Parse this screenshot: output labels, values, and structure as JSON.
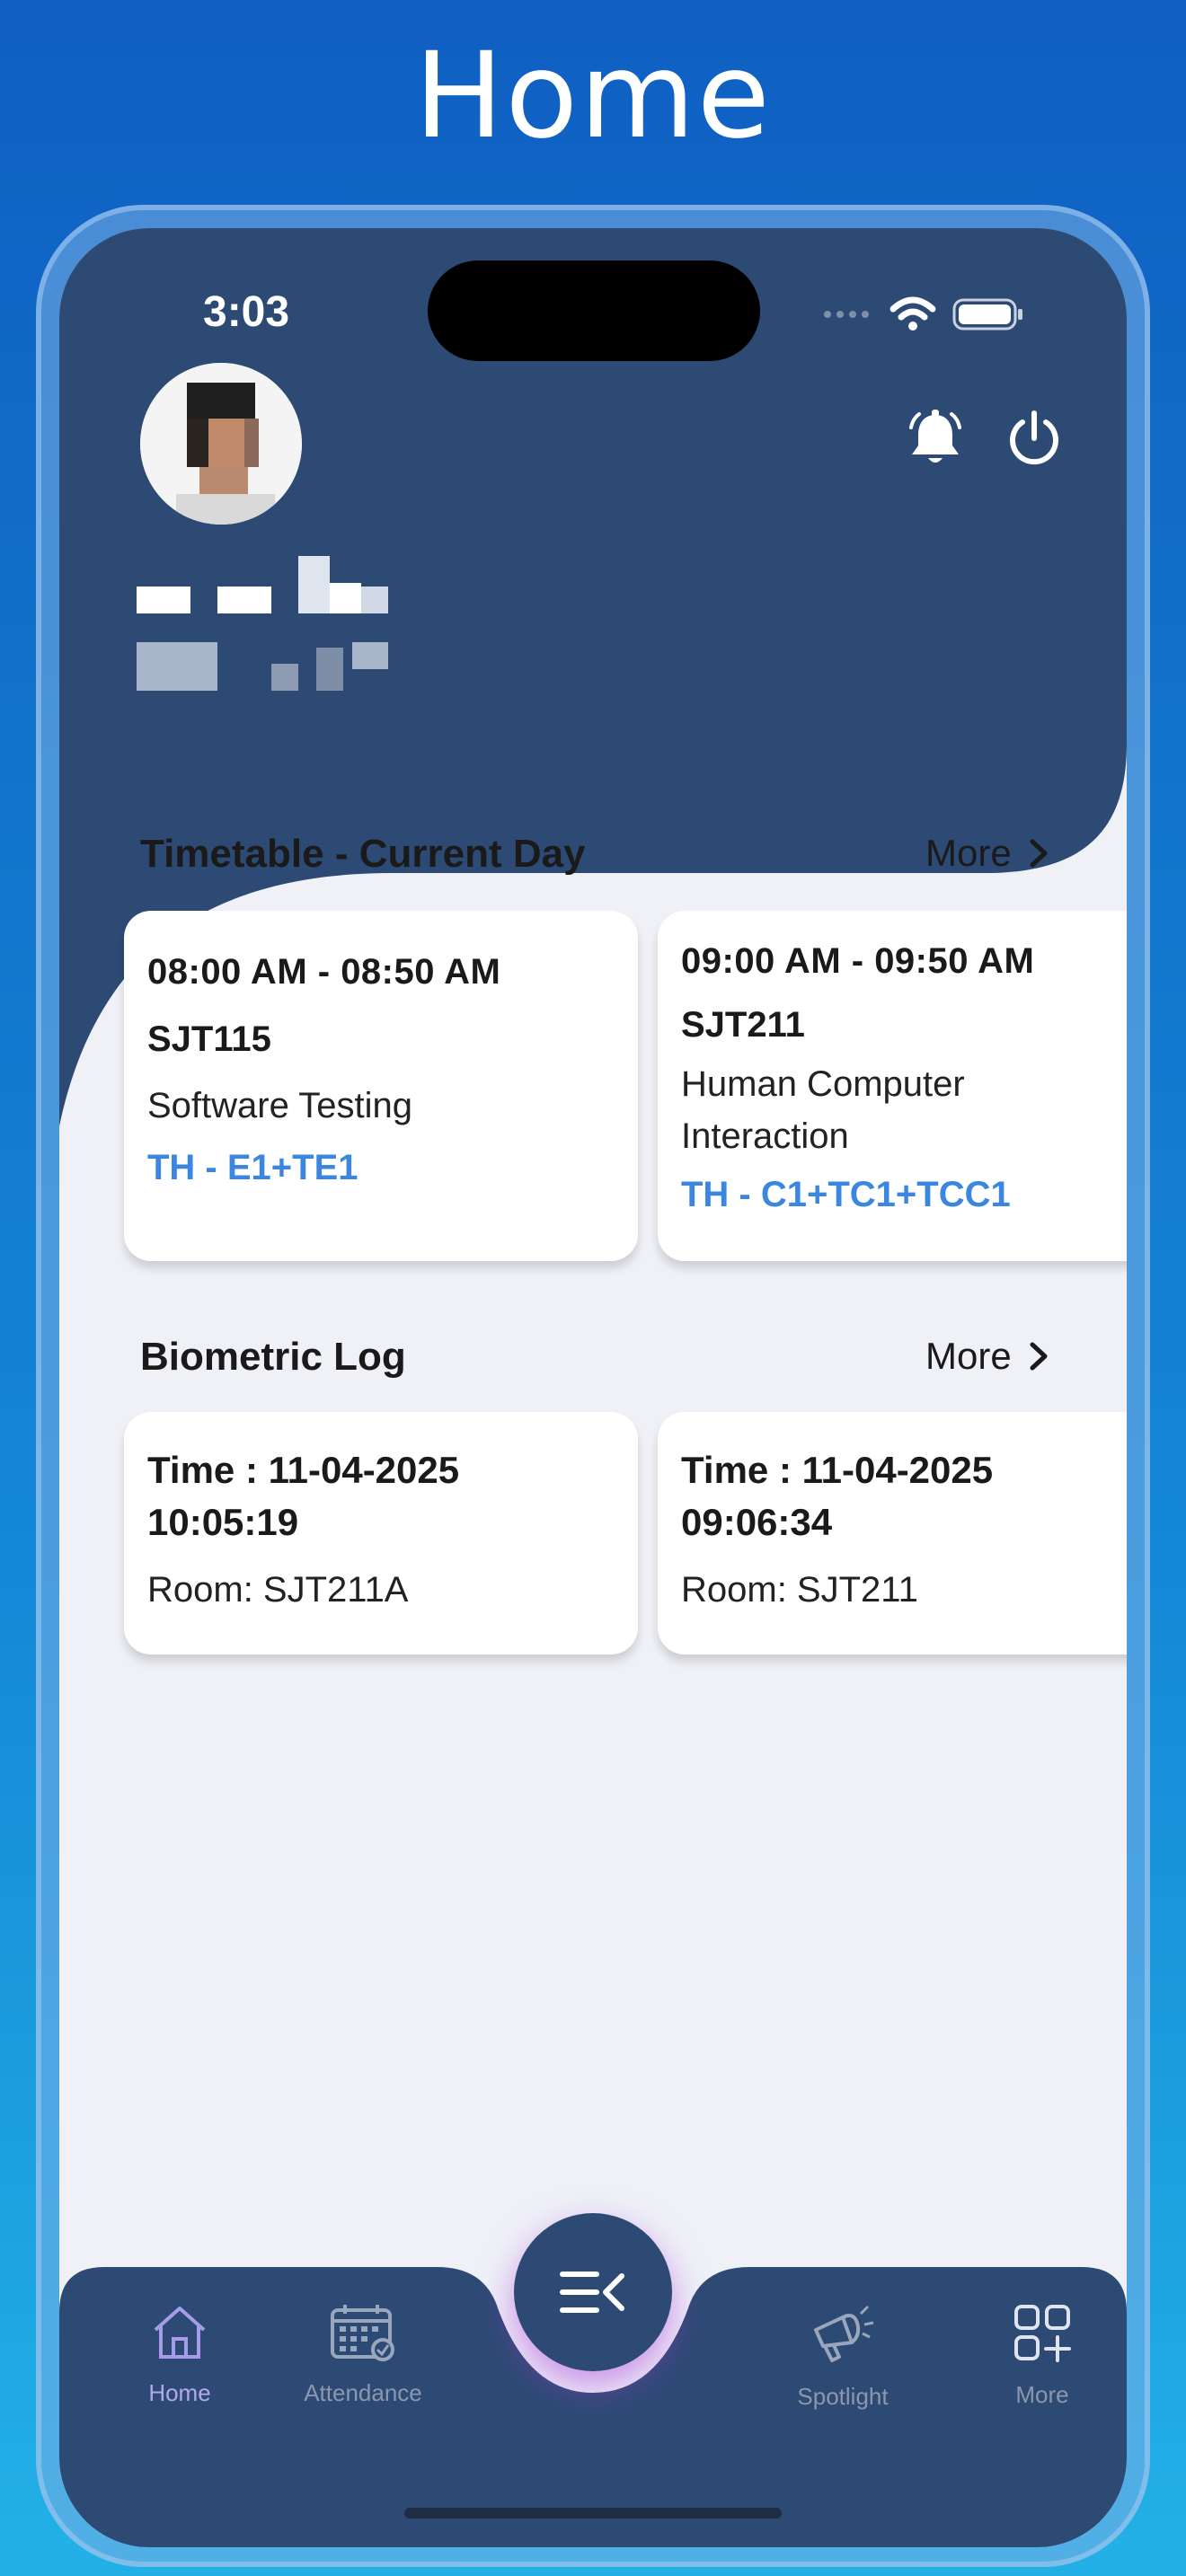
{
  "banner": {
    "title": "Home"
  },
  "status_bar": {
    "time": "3:03"
  },
  "colors": {
    "header": "#2d4a74",
    "accent_link": "#3a86e0",
    "page_bg": "#eff1f7",
    "gradient_top": "#0f5fc2",
    "gradient_bottom": "#22b1e6"
  },
  "header": {
    "icons": [
      "bell-icon",
      "power-icon"
    ]
  },
  "timetable": {
    "title": "Timetable - Current Day",
    "more_label": "More",
    "cards": [
      {
        "time": "08:00 AM - 08:50 AM",
        "code": "SJT115",
        "subject": "Software Testing",
        "slot": "TH - E1+TE1"
      },
      {
        "time": "09:00 AM - 09:50 AM",
        "code": "SJT211",
        "subject_line1": "Human Computer",
        "subject_line2": "Interaction",
        "slot": "TH - C1+TC1+TCC1"
      }
    ]
  },
  "biometric": {
    "title": "Biometric Log",
    "more_label": "More",
    "cards": [
      {
        "time_line1": "Time : 11-04-2025",
        "time_line2": "10:05:19",
        "room": "Room: SJT211A"
      },
      {
        "time_line1": "Time : 11-04-2025",
        "time_line2": "09:06:34",
        "room": "Room: SJT211"
      }
    ]
  },
  "nav": {
    "items": [
      {
        "label": "Home",
        "icon": "home-icon",
        "active": true
      },
      {
        "label": "Attendance",
        "icon": "calendar-icon",
        "active": false
      },
      {
        "label": "Spotlight",
        "icon": "megaphone-icon",
        "active": false
      },
      {
        "label": "More",
        "icon": "grid-plus-icon",
        "active": false
      }
    ],
    "center_icon": "menu-collapse-icon"
  }
}
